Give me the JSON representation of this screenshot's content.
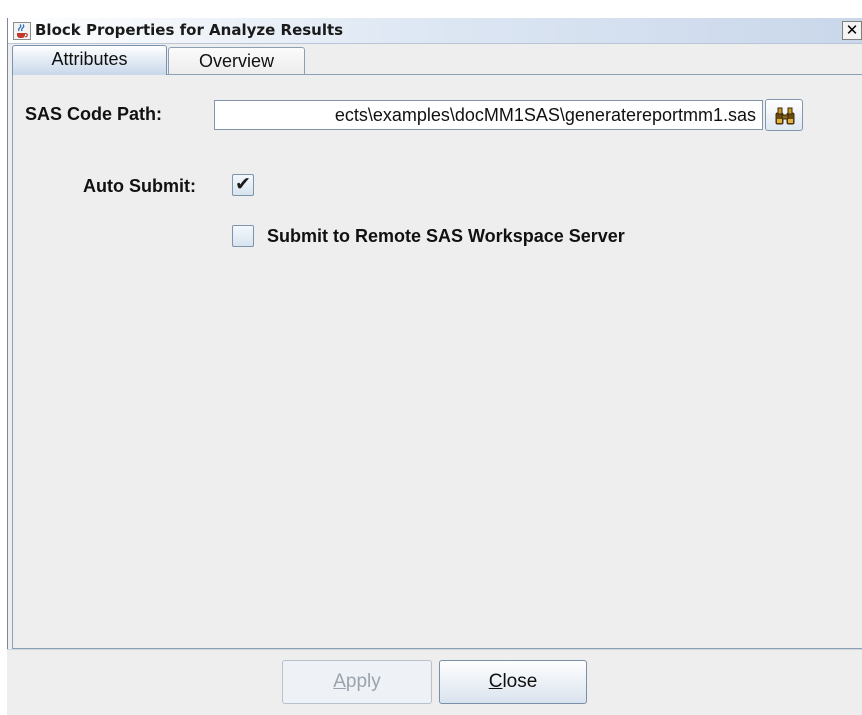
{
  "window": {
    "title": "Block Properties for Analyze Results",
    "close_glyph": "✕",
    "app_icon": "java-coffee-icon"
  },
  "tabs": [
    {
      "label": "Attributes",
      "active": true
    },
    {
      "label": "Overview",
      "active": false
    }
  ],
  "form": {
    "sas_code_path": {
      "label": "SAS Code Path:",
      "value": "ects\\examples\\docMM1SAS\\generatereportmm1.sas",
      "browse_icon": "binoculars-icon"
    },
    "auto_submit": {
      "label": "Auto Submit:",
      "checked": true
    },
    "remote_submit": {
      "label": "Submit to Remote SAS Workspace Server",
      "checked": false
    }
  },
  "buttons": {
    "apply": {
      "mnemonic": "A",
      "rest": "pply",
      "enabled": false
    },
    "close": {
      "mnemonic": "C",
      "rest": "lose",
      "enabled": true
    }
  },
  "colors": {
    "accent": "#7a92ad",
    "panel_bg": "#eeeeee"
  }
}
